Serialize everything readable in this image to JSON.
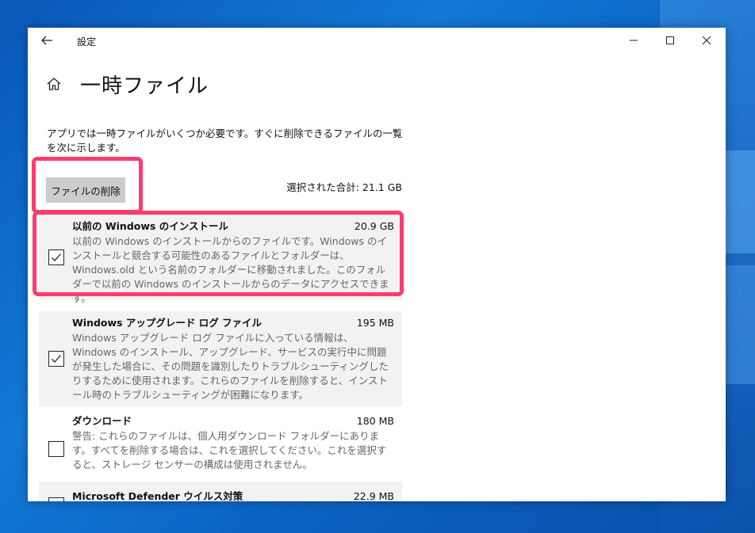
{
  "window": {
    "app_title": "設定",
    "page_title": "一時ファイル"
  },
  "content": {
    "description": "アプリでは一時ファイルがいくつか必要です。すぐに削除できるファイルの一覧を次に示します。",
    "delete_button": "ファイルの削除",
    "selected_total": "選択された合計: 21.1 GB"
  },
  "items": [
    {
      "name": "以前の Windows のインストール",
      "size": "20.9 GB",
      "checked": true,
      "description": "以前の Windows のインストールからのファイルです。Windows のインストールと競合する可能性のあるファイルとフォルダーは、Windows.old という名前のフォルダーに移動されました。このフォルダーで以前の Windows のインストールからのデータにアクセスできます。"
    },
    {
      "name": "Windows アップグレード ログ ファイル",
      "size": "195 MB",
      "checked": true,
      "description": "Windows アップグレード ログ ファイルに入っている情報は、Windows のインストール、アップグレード、サービスの実行中に問題が発生した場合に、その問題を識別したりトラブルシューティングしたりするために使用されます。これらのファイルを削除すると、インストール時のトラブルシューティングが困難になります。"
    },
    {
      "name": "ダウンロード",
      "size": "180 MB",
      "checked": false,
      "description": "警告: これらのファイルは、個人用ダウンロード フォルダーにあります。すべてを削除する場合は、これを選択してください。これを選択すると、ストレージ センサーの構成は使用されません。"
    },
    {
      "name": "Microsoft Defender ウイルス対策",
      "size": "22.9 MB",
      "checked": false,
      "description": ""
    }
  ],
  "colors": {
    "highlight": "#ff3b70",
    "button_bg": "#cccccc",
    "shaded_row": "#f2f2f2",
    "desktop": "#1279d6"
  }
}
